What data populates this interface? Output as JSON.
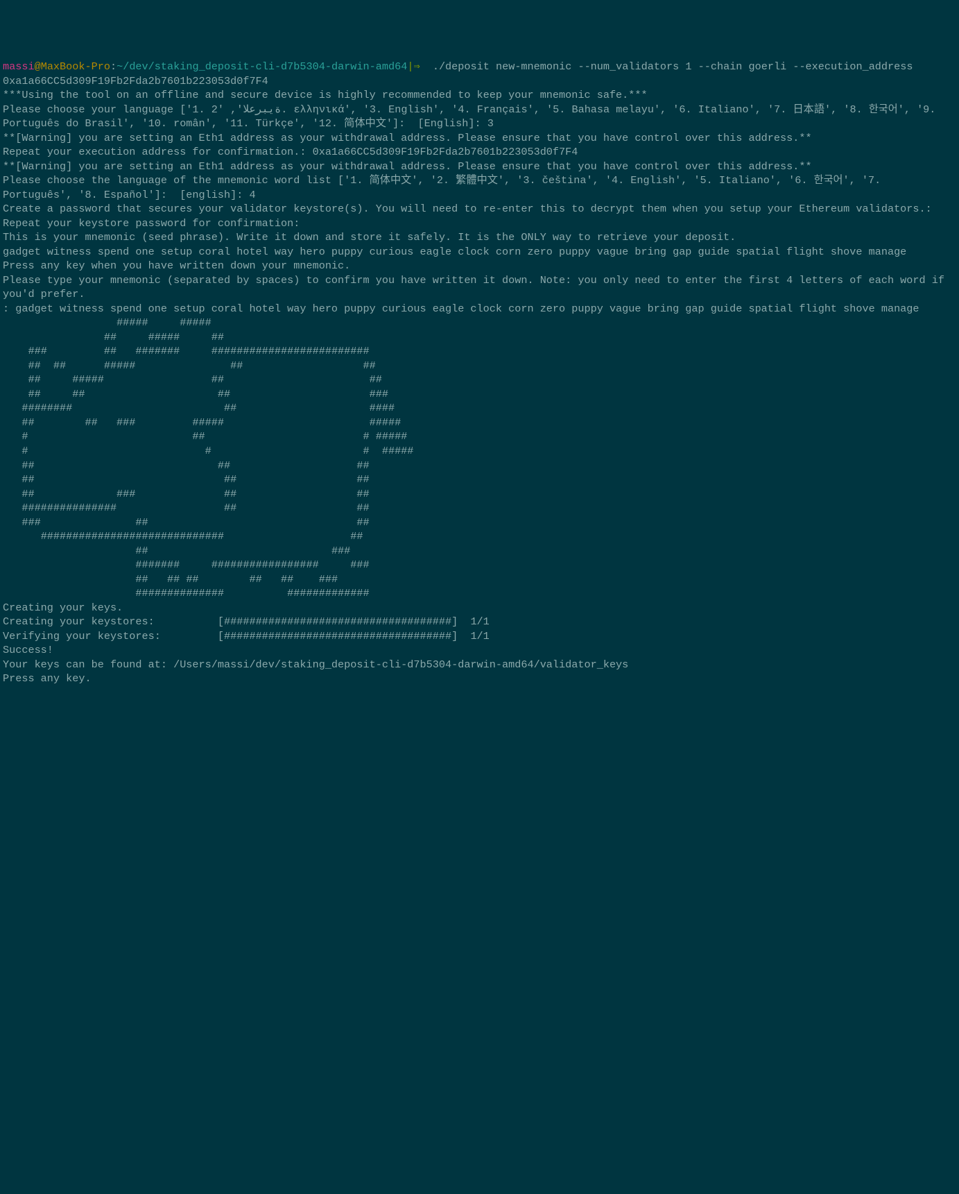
{
  "prompt": {
    "user": "massi",
    "at": "@",
    "host": "MaxBook-Pro",
    "sep": ":",
    "path": "~/dev/staking_deposit-cli-d7b5304-darwin-amd64",
    "branch": "|⇒ ",
    "command": " ./deposit new-mnemonic --num_validators 1 --chain goerli --execution_address 0xa1a66CC5d309F19Fb2Fda2b7601b223053d0f7F4"
  },
  "lines": {
    "l1": "",
    "l2": "***Using the tool on an offline and secure device is highly recommended to keep your mnemonic safe.***",
    "l3": "",
    "l4": "Please choose your language ['1. ةيبرعلا', '2. ελληνικά', '3. English', '4. Français', '5. Bahasa melayu', '6. Italiano', '7. 日本語', '8. 한국어', '9. Português do Brasil', '10. român', '11. Türkçe', '12. 简体中文']:  [English]: 3",
    "l5": "",
    "l6": "**[Warning] you are setting an Eth1 address as your withdrawal address. Please ensure that you have control over this address.**",
    "l7": "",
    "l8": "Repeat your execution address for confirmation.: 0xa1a66CC5d309F19Fb2Fda2b7601b223053d0f7F4",
    "l9": "",
    "l10": "**[Warning] you are setting an Eth1 address as your withdrawal address. Please ensure that you have control over this address.**",
    "l11": "",
    "l12": "Please choose the language of the mnemonic word list ['1. 简体中文', '2. 繁體中文', '3. čeština', '4. English', '5. Italiano', '6. 한국어', '7. Português', '8. Español']:  [english]: 4",
    "l13": "Create a password that secures your validator keystore(s). You will need to re-enter this to decrypt them when you setup your Ethereum validators.:",
    "l14": "Repeat your keystore password for confirmation:",
    "l15": "This is your mnemonic (seed phrase). Write it down and store it safely. It is the ONLY way to retrieve your deposit.",
    "l16": "",
    "l17": "",
    "l18": "gadget witness spend one setup coral hotel way hero puppy curious eagle clock corn zero puppy vague bring gap guide spatial flight shove manage",
    "l19": "",
    "l20": "",
    "l21": "Press any key when you have written down your mnemonic.",
    "l22": "Please type your mnemonic (separated by spaces) to confirm you have written it down. Note: you only need to enter the first 4 letters of each word if you'd prefer.",
    "l23": "",
    "l24": ": gadget witness spend one setup coral hotel way hero puppy curious eagle clock corn zero puppy vague bring gap guide spatial flight shove manage",
    "l25": "",
    "l26": "",
    "a1": "                  #####     #####",
    "a2": "                ##     #####     ##",
    "a3": "    ###         ##   #######     #########################",
    "a4": "    ##  ##      #####               ##                   ##",
    "a5": "    ##     #####                 ##                       ##",
    "a6": "    ##     ##                     ##                      ###",
    "a7": "   ########                        ##                     ####",
    "a8": "   ##        ##   ###         #####                       #####",
    "a9": "   #                          ##                         # #####",
    "a10": "   #                            #                        #  #####",
    "a11": "   ##                             ##                    ##",
    "a12": "   ##                              ##                   ##",
    "a13": "   ##             ###              ##                   ##",
    "a14": "   ###############                 ##                   ##",
    "a15": "   ###               ##                                 ##",
    "a16": "      #############################                    ##",
    "a17": "                     ##                             ###",
    "a18": "                     #######     #################     ###",
    "a19": "                     ##   ## ##        ##   ##    ###",
    "a20": "                     ##############          #############",
    "l27": "",
    "l28": "Creating your keys.",
    "l29": "Creating your keystores:\t  [####################################]  1/1",
    "l30": "Verifying your keystores:\t  [####################################]  1/1",
    "l31": "",
    "l32": "Success!",
    "l33": "Your keys can be found at: /Users/massi/dev/staking_deposit-cli-d7b5304-darwin-amd64/validator_keys",
    "l34": "",
    "l35": "",
    "l36": "Press any key."
  }
}
